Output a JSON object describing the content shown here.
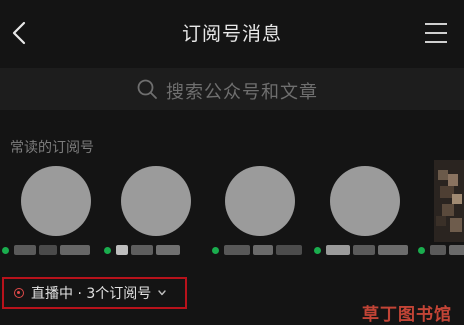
{
  "header": {
    "title": "订阅号消息",
    "back_icon": "chevron-left-icon",
    "menu_icon": "menu-icon"
  },
  "search": {
    "placeholder": "搜索公众号和文章",
    "icon": "search-icon"
  },
  "frequent": {
    "label": "常读的订阅号",
    "items": [
      {
        "online": true
      },
      {
        "online": true
      },
      {
        "online": true
      },
      {
        "online": true
      },
      {
        "online": true
      }
    ]
  },
  "live": {
    "text": "直播中 · 3个订阅号",
    "icon": "live-dot-icon"
  },
  "watermark": "草丁图书馆",
  "colors": {
    "background": "#141414",
    "online_dot": "#1aad4e",
    "live_border": "#b8121b"
  }
}
